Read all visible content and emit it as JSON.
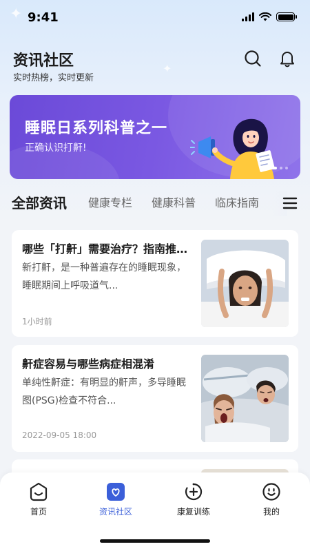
{
  "status_bar": {
    "time": "9:41"
  },
  "header": {
    "title": "资讯社区",
    "subtitle": "实时热榜，实时更新",
    "icons": [
      "search-icon",
      "bell-icon"
    ]
  },
  "banner": {
    "title": "睡眠日系列科普之一",
    "subtitle": "正确认识打鼾!",
    "active_slide": 1,
    "slide_count": 3
  },
  "tabs": [
    {
      "label": "全部资讯",
      "active": true
    },
    {
      "label": "健康专栏",
      "active": false
    },
    {
      "label": "健康科普",
      "active": false
    },
    {
      "label": "临床指南",
      "active": false
    }
  ],
  "articles": [
    {
      "title": "哪些「打鼾」需要治疗？指南推荐！",
      "description": "新打鼾，是一种普遍存在的睡眠现象，睡眠期间上呼吸道气...",
      "time": "1小时前"
    },
    {
      "title": "鼾症容易与哪些病症相混淆",
      "description": "单纯性鼾症：有明显的鼾声，多导睡眠图(PSG)检查不符合...",
      "time": "2022-09-05 18:00"
    }
  ],
  "bottom_nav": [
    {
      "label": "首页",
      "icon": "home-smile-icon",
      "active": false
    },
    {
      "label": "资讯社区",
      "icon": "heart-badge-icon",
      "active": true
    },
    {
      "label": "康复训练",
      "icon": "plus-circle-icon",
      "active": false
    },
    {
      "label": "我的",
      "icon": "profile-smile-icon",
      "active": false
    }
  ],
  "colors": {
    "accent": "#3b5fd9",
    "banner": "#7a58e2",
    "background": "#f2f4f8"
  }
}
